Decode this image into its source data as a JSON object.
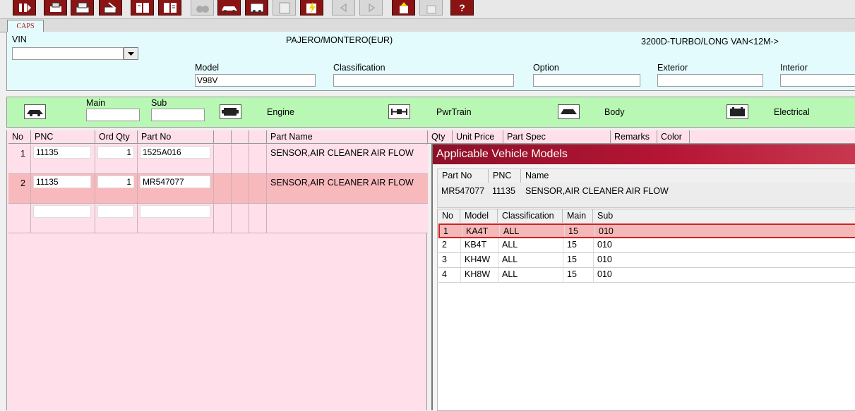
{
  "toolbar": {
    "buttons": [
      {
        "icon": "exit-icon",
        "enabled": true
      },
      {
        "icon": "print-list-icon",
        "enabled": true
      },
      {
        "icon": "printer-icon",
        "enabled": true
      },
      {
        "icon": "print-edit-icon",
        "enabled": true
      },
      {
        "icon": "book-open-icon",
        "enabled": true
      },
      {
        "icon": "book-list-icon",
        "enabled": true
      },
      {
        "icon": "binoculars-icon",
        "enabled": false
      },
      {
        "icon": "car-search-icon",
        "enabled": true
      },
      {
        "icon": "vehicle-info-icon",
        "enabled": true
      },
      {
        "icon": "document-list-icon",
        "enabled": false
      },
      {
        "icon": "lightning-icon",
        "enabled": true
      },
      {
        "icon": "arrow-left-icon",
        "enabled": false
      },
      {
        "icon": "arrow-right-icon",
        "enabled": false
      },
      {
        "icon": "part-add-icon",
        "enabled": true
      },
      {
        "icon": "part-move-icon",
        "enabled": false
      },
      {
        "icon": "help-icon",
        "enabled": true,
        "glyph": "?"
      }
    ]
  },
  "tabs": [
    {
      "label": "CAPS"
    }
  ],
  "vehicle": {
    "vin_label": "VIN",
    "vin_value": "",
    "catalog": "PAJERO/MONTERO(EUR)",
    "spec": "3200D-TURBO/LONG VAN<12M->",
    "model_label": "Model",
    "model_value": "V98V",
    "classification_label": "Classification",
    "classification_value": "",
    "option_label": "Option",
    "option_value": "",
    "exterior_label": "Exterior",
    "exterior_value": "",
    "interior_label": "Interior",
    "interior_value": ""
  },
  "groups": {
    "main_label": "Main",
    "sub_label": "Sub",
    "main_value": "",
    "sub_value": "",
    "engine_label": "Engine",
    "pwrtrain_label": "PwrTrain",
    "body_label": "Body",
    "electrical_label": "Electrical"
  },
  "parts_table": {
    "headers": {
      "no": "No",
      "pnc": "PNC",
      "ord_qty": "Ord Qty",
      "part_no": "Part No",
      "part_name": "Part Name",
      "qty": "Qty",
      "unit_price": "Unit Price",
      "part_spec": "Part Spec",
      "remarks": "Remarks",
      "color": "Color"
    },
    "rows": [
      {
        "no": "1",
        "pnc": "11135",
        "ord_qty": "1",
        "part_no": "1525A016",
        "part_name": "SENSOR,AIR CLEANER AIR FLOW"
      },
      {
        "no": "2",
        "pnc": "11135",
        "ord_qty": "1",
        "part_no": "MR547077",
        "part_name": "SENSOR,AIR CLEANER AIR FLOW"
      },
      {
        "no": "",
        "pnc": "",
        "ord_qty": "",
        "part_no": "",
        "part_name": ""
      }
    ]
  },
  "popup": {
    "title": "Applicable Vehicle Models",
    "part_headers": {
      "part_no": "Part No",
      "pnc": "PNC",
      "name": "Name"
    },
    "part_no": "MR547077",
    "pnc": "11135",
    "name": "SENSOR,AIR CLEANER AIR FLOW",
    "model_headers": {
      "no": "No",
      "model": "Model",
      "classification": "Classification",
      "main": "Main",
      "sub": "Sub"
    },
    "models": [
      {
        "no": "1",
        "model": "KA4T",
        "classification": "ALL",
        "main": "15",
        "sub": "010"
      },
      {
        "no": "2",
        "model": "KB4T",
        "classification": "ALL",
        "main": "15",
        "sub": "010"
      },
      {
        "no": "3",
        "model": "KH4W",
        "classification": "ALL",
        "main": "15",
        "sub": "010"
      },
      {
        "no": "4",
        "model": "KH8W",
        "classification": "ALL",
        "main": "15",
        "sub": "010"
      }
    ]
  },
  "colors": {
    "vin_panel": "#e3fbfd",
    "category_bar": "#b8f7b4",
    "grid": "#ffe0ea",
    "toolbar_button": "#8a1414",
    "selected_row": "#f5b8b8",
    "popup_title": "#a01430"
  }
}
